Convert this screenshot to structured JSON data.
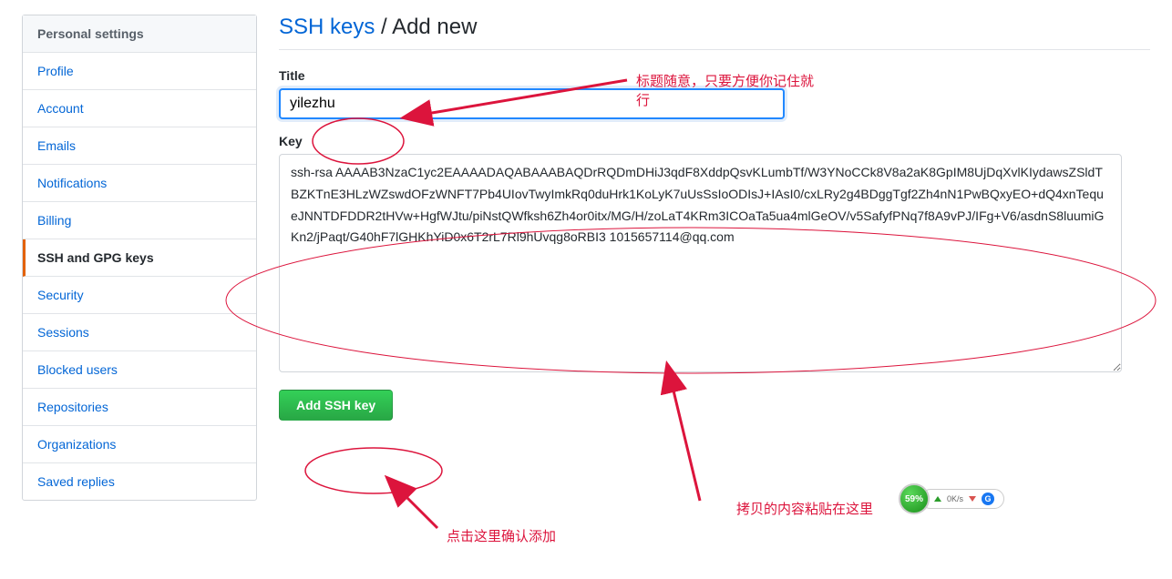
{
  "sidebar": {
    "header": "Personal settings",
    "items": [
      {
        "label": "Profile",
        "name": "sidebar-item-profile",
        "active": false
      },
      {
        "label": "Account",
        "name": "sidebar-item-account",
        "active": false
      },
      {
        "label": "Emails",
        "name": "sidebar-item-emails",
        "active": false
      },
      {
        "label": "Notifications",
        "name": "sidebar-item-notifications",
        "active": false
      },
      {
        "label": "Billing",
        "name": "sidebar-item-billing",
        "active": false
      },
      {
        "label": "SSH and GPG keys",
        "name": "sidebar-item-ssh-gpg",
        "active": true
      },
      {
        "label": "Security",
        "name": "sidebar-item-security",
        "active": false
      },
      {
        "label": "Sessions",
        "name": "sidebar-item-sessions",
        "active": false
      },
      {
        "label": "Blocked users",
        "name": "sidebar-item-blocked",
        "active": false
      },
      {
        "label": "Repositories",
        "name": "sidebar-item-repositories",
        "active": false
      },
      {
        "label": "Organizations",
        "name": "sidebar-item-organizations",
        "active": false
      },
      {
        "label": "Saved replies",
        "name": "sidebar-item-saved-replies",
        "active": false
      }
    ]
  },
  "main": {
    "heading_link": "SSH keys",
    "heading_sep": " / ",
    "heading_rest": "Add new",
    "title_label": "Title",
    "title_value": "yilezhu",
    "key_label": "Key",
    "key_value": "ssh-rsa AAAAB3NzaC1yc2EAAAADAQABAAABAQDrRQDmDHiJ3qdF8XddpQsvKLumbTf/W3YNoCCk8V8a2aK8GpIM8UjDqXvlKIydawsZSldTBZKTnE3HLzWZswdOFzWNFT7Pb4UIovTwyImkRq0duHrk1KoLyK7uUsSsIoODIsJ+IAsI0/cxLRy2g4BDggTgf2Zh4nN1PwBQxyEO+dQ4xnTequeJNNTDFDDR2tHVw+HgfWJtu/piNstQWfksh6Zh4or0itx/MG/H/zoLaT4KRm3ICOaTa5ua4mlGeOV/v5SafyfPNq7f8A9vPJ/IFg+V6/asdnS8luumiGKn2/jPaqt/G40hF7lGHKhYiD0x6T2rL7Rl9hUvqg8oRBI3 1015657114@qq.com",
    "submit_label": "Add SSH key"
  },
  "annotations": {
    "title_note": "标题随意，只要方便你记住就行",
    "key_note": "拷贝的内容粘贴在这里",
    "button_note": "点击这里确认添加"
  },
  "widget": {
    "percent": "59%",
    "up": "0K/s"
  },
  "colors": {
    "link": "#0366d6",
    "active_border": "#e36209",
    "button_bg": "#28a745",
    "annotation": "#dc143c"
  }
}
